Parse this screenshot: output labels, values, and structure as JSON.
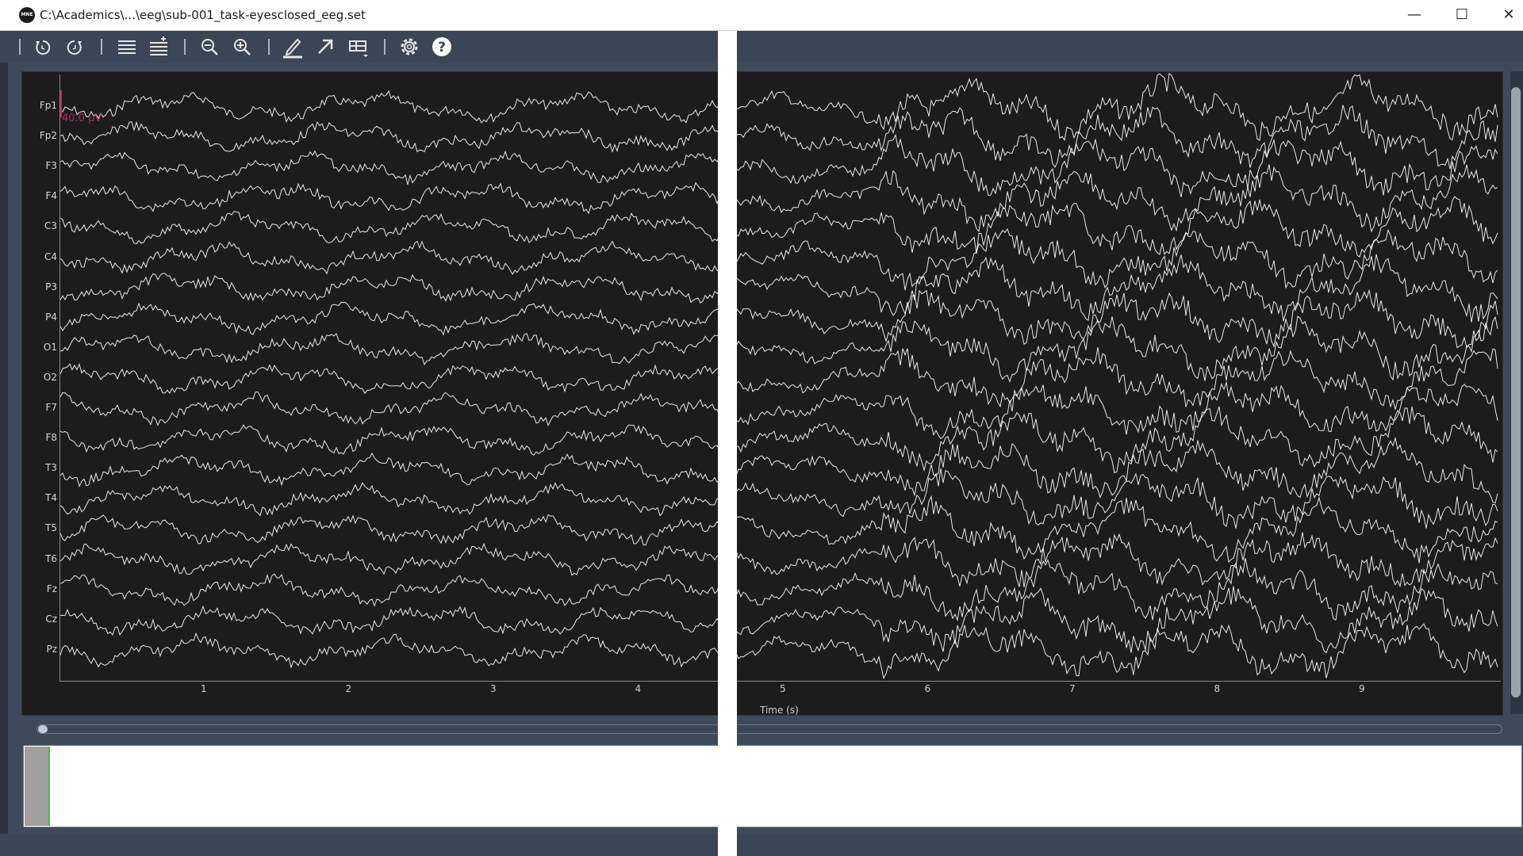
{
  "window": {
    "app_icon_text": "MNE",
    "title": "C:\\Academics\\...\\eeg\\sub-001_task-eyesclosed_eeg.set",
    "minimize": "—",
    "maximize": "☐",
    "close": "✕"
  },
  "toolbar": {
    "buttons": [
      "rewind-icon",
      "fast-forward-icon",
      "fewer-channels-icon",
      "more-channels-icon",
      "zoom-out-icon",
      "zoom-in-icon",
      "annotation-mode-icon",
      "projectors-icon",
      "overview-bar-icon",
      "settings-icon",
      "help-icon"
    ]
  },
  "plot": {
    "channels": [
      "Fp1",
      "Fp2",
      "F3",
      "F4",
      "C3",
      "C4",
      "P3",
      "P4",
      "O1",
      "O2",
      "F7",
      "F8",
      "T3",
      "T4",
      "T5",
      "T6",
      "Fz",
      "Cz",
      "Pz"
    ],
    "x_ticks": [
      "1",
      "2",
      "3",
      "4",
      "5",
      "6",
      "7",
      "8",
      "9"
    ],
    "xlabel": "Time (s)",
    "scale_label": "40.0 µV",
    "trace_color": "#ffffff",
    "background": "#1c1c1c",
    "scale_color": "#b22a63"
  },
  "overview": {
    "window_color": "#a0a0a0",
    "marker_color": "#2ecc40"
  }
}
